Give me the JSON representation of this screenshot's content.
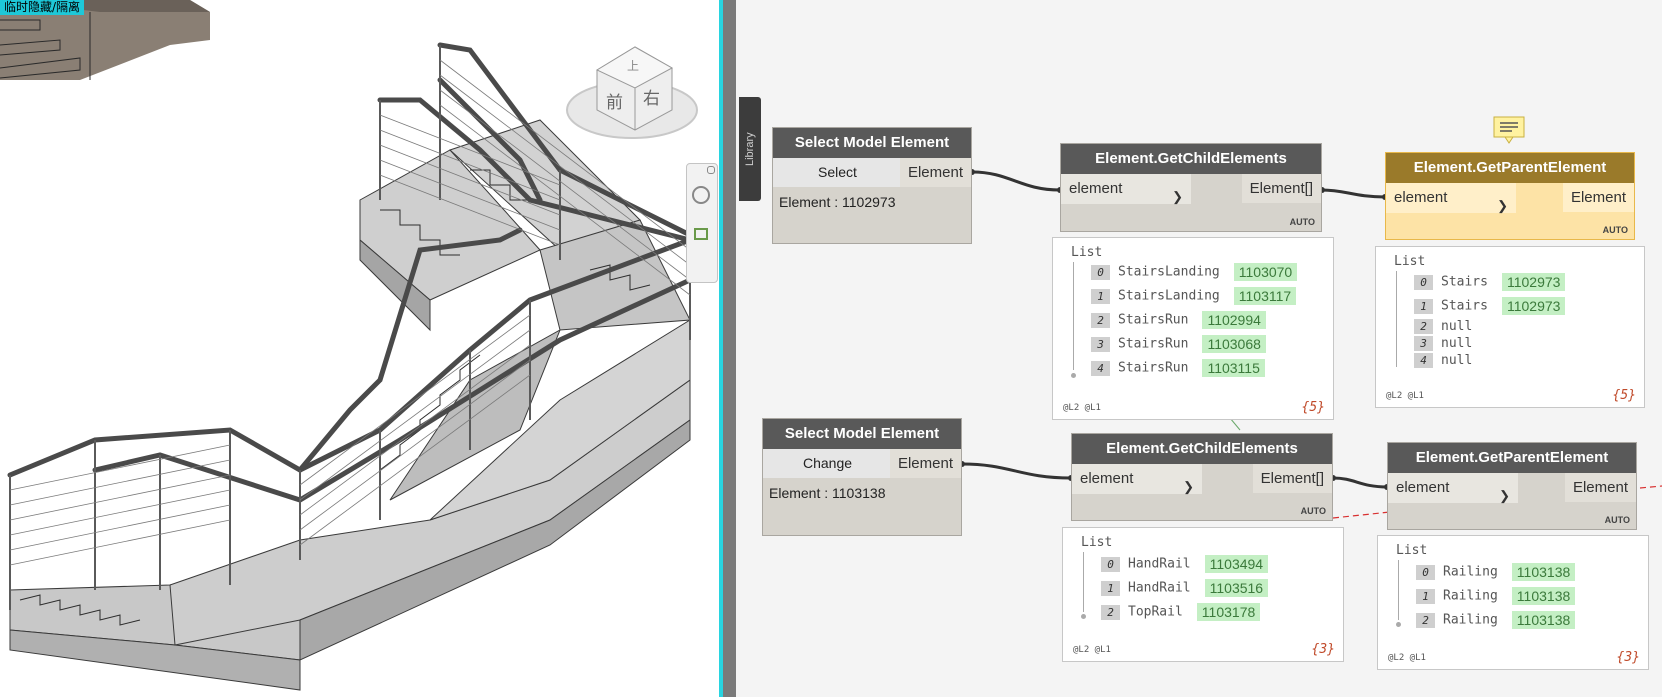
{
  "revit_view": {
    "tag_label": "临时隐藏/隔离",
    "viewcube": {
      "top_face": "上",
      "front_face": "前",
      "right_face": "右"
    }
  },
  "library_tab": {
    "label": "Library"
  },
  "nodes": {
    "select_1": {
      "title": "Select Model Element",
      "button": "Select",
      "output": "Element",
      "value": "Element : 1102973"
    },
    "child_1": {
      "title": "Element.GetChildElements",
      "input": "element",
      "output": "Element[]",
      "lacing": "AUTO"
    },
    "parent_1": {
      "title": "Element.GetParentElement",
      "input": "element",
      "output": "Element",
      "lacing": "AUTO"
    },
    "select_2": {
      "title": "Select Model Element",
      "button": "Change",
      "output": "Element",
      "value": "Element : 1103138"
    },
    "child_2": {
      "title": "Element.GetChildElements",
      "input": "element",
      "output": "Element[]",
      "lacing": "AUTO"
    },
    "parent_2": {
      "title": "Element.GetParentElement",
      "input": "element",
      "output": "Element",
      "lacing": "AUTO"
    }
  },
  "previews": {
    "child_1": {
      "title": "List",
      "levels": "@L2 @L1",
      "count": "{5}",
      "items": [
        {
          "index": "0",
          "name": "StairsLanding",
          "id": "1103070"
        },
        {
          "index": "1",
          "name": "StairsLanding",
          "id": "1103117"
        },
        {
          "index": "2",
          "name": "StairsRun",
          "id": "1102994"
        },
        {
          "index": "3",
          "name": "StairsRun",
          "id": "1103068"
        },
        {
          "index": "4",
          "name": "StairsRun",
          "id": "1103115"
        }
      ]
    },
    "parent_1": {
      "title": "List",
      "levels": "@L2 @L1",
      "count": "{5}",
      "items": [
        {
          "index": "0",
          "name": "Stairs",
          "id": "1102973"
        },
        {
          "index": "1",
          "name": "Stairs",
          "id": "1102973"
        },
        {
          "index": "2",
          "name": "null",
          "id": null
        },
        {
          "index": "3",
          "name": "null",
          "id": null
        },
        {
          "index": "4",
          "name": "null",
          "id": null
        }
      ]
    },
    "child_2": {
      "title": "List",
      "levels": "@L2 @L1",
      "count": "{3}",
      "items": [
        {
          "index": "0",
          "name": "HandRail",
          "id": "1103494"
        },
        {
          "index": "1",
          "name": "HandRail",
          "id": "1103516"
        },
        {
          "index": "2",
          "name": "TopRail",
          "id": "1103178"
        }
      ]
    },
    "parent_2": {
      "title": "List",
      "levels": "@L2 @L1",
      "count": "{3}",
      "items": [
        {
          "index": "0",
          "name": "Railing",
          "id": "1103138"
        },
        {
          "index": "1",
          "name": "Railing",
          "id": "1103138"
        },
        {
          "index": "2",
          "name": "Railing",
          "id": "1103138"
        }
      ]
    }
  },
  "colors": {
    "cyan_divider": "#28d4e0",
    "node_header": "#595959",
    "selected_node_header": "#9a7a2a",
    "selected_node_body": "#fde3a6",
    "id_badge_bg": "#c4efc4",
    "count_text": "#c04a2a",
    "wire": "#333333",
    "error_wire": "#d83030"
  }
}
